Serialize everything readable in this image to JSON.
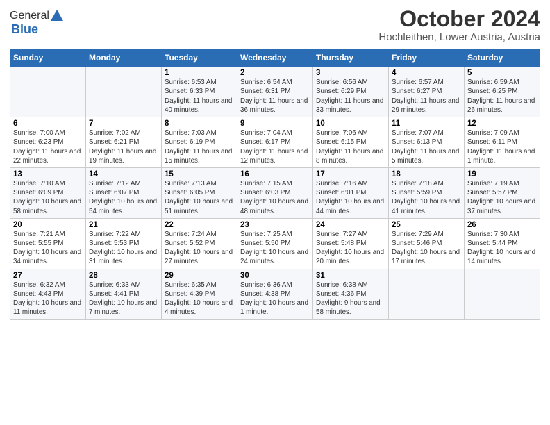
{
  "header": {
    "logo_general": "General",
    "logo_blue": "Blue",
    "title": "October 2024",
    "subtitle": "Hochleithen, Lower Austria, Austria"
  },
  "calendar": {
    "days_of_week": [
      "Sunday",
      "Monday",
      "Tuesday",
      "Wednesday",
      "Thursday",
      "Friday",
      "Saturday"
    ],
    "weeks": [
      [
        {
          "day": "",
          "info": ""
        },
        {
          "day": "",
          "info": ""
        },
        {
          "day": "1",
          "info": "Sunrise: 6:53 AM\nSunset: 6:33 PM\nDaylight: 11 hours and 40 minutes."
        },
        {
          "day": "2",
          "info": "Sunrise: 6:54 AM\nSunset: 6:31 PM\nDaylight: 11 hours and 36 minutes."
        },
        {
          "day": "3",
          "info": "Sunrise: 6:56 AM\nSunset: 6:29 PM\nDaylight: 11 hours and 33 minutes."
        },
        {
          "day": "4",
          "info": "Sunrise: 6:57 AM\nSunset: 6:27 PM\nDaylight: 11 hours and 29 minutes."
        },
        {
          "day": "5",
          "info": "Sunrise: 6:59 AM\nSunset: 6:25 PM\nDaylight: 11 hours and 26 minutes."
        }
      ],
      [
        {
          "day": "6",
          "info": "Sunrise: 7:00 AM\nSunset: 6:23 PM\nDaylight: 11 hours and 22 minutes."
        },
        {
          "day": "7",
          "info": "Sunrise: 7:02 AM\nSunset: 6:21 PM\nDaylight: 11 hours and 19 minutes."
        },
        {
          "day": "8",
          "info": "Sunrise: 7:03 AM\nSunset: 6:19 PM\nDaylight: 11 hours and 15 minutes."
        },
        {
          "day": "9",
          "info": "Sunrise: 7:04 AM\nSunset: 6:17 PM\nDaylight: 11 hours and 12 minutes."
        },
        {
          "day": "10",
          "info": "Sunrise: 7:06 AM\nSunset: 6:15 PM\nDaylight: 11 hours and 8 minutes."
        },
        {
          "day": "11",
          "info": "Sunrise: 7:07 AM\nSunset: 6:13 PM\nDaylight: 11 hours and 5 minutes."
        },
        {
          "day": "12",
          "info": "Sunrise: 7:09 AM\nSunset: 6:11 PM\nDaylight: 11 hours and 1 minute."
        }
      ],
      [
        {
          "day": "13",
          "info": "Sunrise: 7:10 AM\nSunset: 6:09 PM\nDaylight: 10 hours and 58 minutes."
        },
        {
          "day": "14",
          "info": "Sunrise: 7:12 AM\nSunset: 6:07 PM\nDaylight: 10 hours and 54 minutes."
        },
        {
          "day": "15",
          "info": "Sunrise: 7:13 AM\nSunset: 6:05 PM\nDaylight: 10 hours and 51 minutes."
        },
        {
          "day": "16",
          "info": "Sunrise: 7:15 AM\nSunset: 6:03 PM\nDaylight: 10 hours and 48 minutes."
        },
        {
          "day": "17",
          "info": "Sunrise: 7:16 AM\nSunset: 6:01 PM\nDaylight: 10 hours and 44 minutes."
        },
        {
          "day": "18",
          "info": "Sunrise: 7:18 AM\nSunset: 5:59 PM\nDaylight: 10 hours and 41 minutes."
        },
        {
          "day": "19",
          "info": "Sunrise: 7:19 AM\nSunset: 5:57 PM\nDaylight: 10 hours and 37 minutes."
        }
      ],
      [
        {
          "day": "20",
          "info": "Sunrise: 7:21 AM\nSunset: 5:55 PM\nDaylight: 10 hours and 34 minutes."
        },
        {
          "day": "21",
          "info": "Sunrise: 7:22 AM\nSunset: 5:53 PM\nDaylight: 10 hours and 31 minutes."
        },
        {
          "day": "22",
          "info": "Sunrise: 7:24 AM\nSunset: 5:52 PM\nDaylight: 10 hours and 27 minutes."
        },
        {
          "day": "23",
          "info": "Sunrise: 7:25 AM\nSunset: 5:50 PM\nDaylight: 10 hours and 24 minutes."
        },
        {
          "day": "24",
          "info": "Sunrise: 7:27 AM\nSunset: 5:48 PM\nDaylight: 10 hours and 20 minutes."
        },
        {
          "day": "25",
          "info": "Sunrise: 7:29 AM\nSunset: 5:46 PM\nDaylight: 10 hours and 17 minutes."
        },
        {
          "day": "26",
          "info": "Sunrise: 7:30 AM\nSunset: 5:44 PM\nDaylight: 10 hours and 14 minutes."
        }
      ],
      [
        {
          "day": "27",
          "info": "Sunrise: 6:32 AM\nSunset: 4:43 PM\nDaylight: 10 hours and 11 minutes."
        },
        {
          "day": "28",
          "info": "Sunrise: 6:33 AM\nSunset: 4:41 PM\nDaylight: 10 hours and 7 minutes."
        },
        {
          "day": "29",
          "info": "Sunrise: 6:35 AM\nSunset: 4:39 PM\nDaylight: 10 hours and 4 minutes."
        },
        {
          "day": "30",
          "info": "Sunrise: 6:36 AM\nSunset: 4:38 PM\nDaylight: 10 hours and 1 minute."
        },
        {
          "day": "31",
          "info": "Sunrise: 6:38 AM\nSunset: 4:36 PM\nDaylight: 9 hours and 58 minutes."
        },
        {
          "day": "",
          "info": ""
        },
        {
          "day": "",
          "info": ""
        }
      ]
    ]
  }
}
